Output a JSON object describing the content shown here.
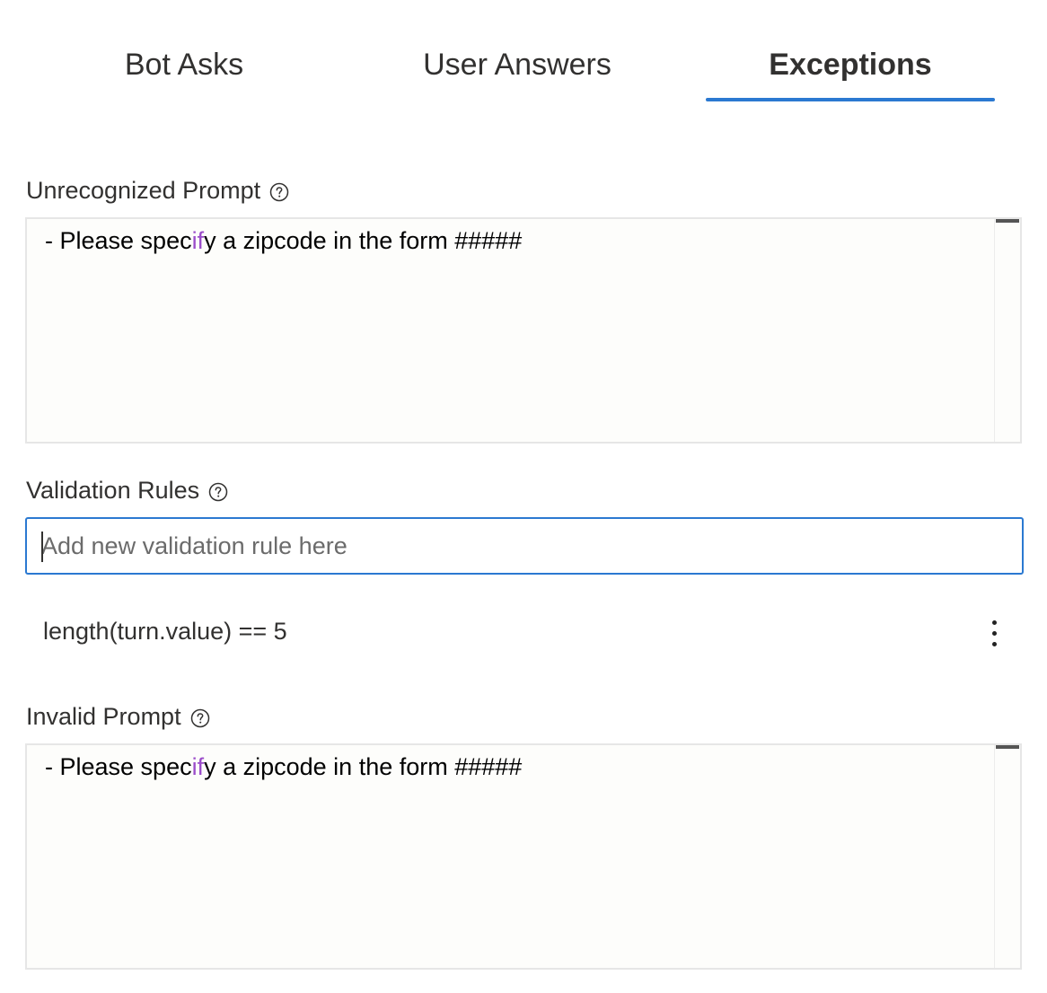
{
  "tabs": [
    {
      "label": "Bot Asks"
    },
    {
      "label": "User Answers"
    },
    {
      "label": "Exceptions"
    }
  ],
  "active_tab": "Exceptions",
  "colors": {
    "accent": "#2b79d1",
    "keyword": "#9b4dca"
  },
  "unrecognized_prompt": {
    "label": "Unrecognized Prompt",
    "help_icon": "question-circle-icon",
    "line_prefix": "- Please spec",
    "line_keyword": "if",
    "line_suffix": "y a zipcode in the form #####"
  },
  "validation_rules": {
    "label": "Validation Rules",
    "help_icon": "question-circle-icon",
    "input_placeholder": "Add new validation rule here",
    "input_value": "",
    "rules": [
      {
        "expression": "length(turn.value) == 5",
        "menu_icon": "more-vertical-icon"
      }
    ]
  },
  "invalid_prompt": {
    "label": "Invalid Prompt",
    "help_icon": "question-circle-icon",
    "line_prefix": "- Please spec",
    "line_keyword": "if",
    "line_suffix": "y a zipcode in the form #####"
  }
}
